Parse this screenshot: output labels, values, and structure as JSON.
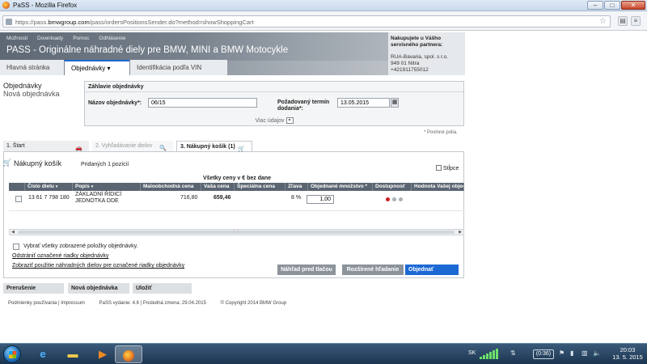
{
  "window": {
    "title": "PaSS - Mozilla Firefox",
    "url_prefix": "https://pass.",
    "url_domain": "bmwgroup.com",
    "url_path": "/pass/ordersPositionsSender.do?method=showShoppingCart"
  },
  "header": {
    "top_menu": [
      "Možnosti",
      "Downloady",
      "Pomoc",
      "Odhlásenie"
    ],
    "app_title": "PASS - Originálne náhradné diely pre BMW, MINI a BMW Motocykle",
    "partner_title": "Nakupujete u Vášho servisného partnera:",
    "partner_lines": [
      "RUA-Bavaria, spol. s r.o.",
      "949 01 Nitra",
      "+421911755012"
    ]
  },
  "tabs": {
    "home": "Hlavná stránka",
    "orders": "Objednávky",
    "orders_arrow": "▾",
    "vin": "Identifikácia podľa VIN"
  },
  "left": {
    "title": "Objednávky",
    "subtitle": "Nová objednávka"
  },
  "order_header": {
    "title": "Záhlavie objednávky",
    "name_label": "Názov objednávky*:",
    "name_value": "06/15",
    "date_label_1": "Požadovaný termín",
    "date_label_2": "dodania*:",
    "date_value": "13.05.2015",
    "more_data": "Viac údajov",
    "required_note": "* Povinné polia."
  },
  "steps": {
    "s1": "1. Štart",
    "s2": "2. Vyhľadávanie dielov",
    "s3": "3. Nákupný košík (1)"
  },
  "cart": {
    "title": "Nákupný košík",
    "added": "Pridaných 1 pozícií",
    "columns_button": "Stĺpce",
    "prices_note": "Všetky ceny v € bez dane",
    "columns": {
      "part_no": "Číslo dielu",
      "desc": "Popis",
      "retail": "Maloobchodná cena",
      "your_price": "Vaša cena",
      "special": "Špeciálna cena",
      "discount": "Zľava",
      "qty": "Objednané množstvo *",
      "avail": "Dostupnosť",
      "value": "Hodnota Vašej objednávky"
    },
    "rows": [
      {
        "part_no": "13 61 7 798 180",
        "desc_1": "ZÁKLADNÍ ŘÍDICÍ",
        "desc_2": "JEDNOTKA DDE",
        "retail": "716,80",
        "your_price": "659,46",
        "discount": "8 %",
        "qty": "1,00"
      }
    ],
    "availability_colors": [
      "#cc1f1f",
      "#aab0b7",
      "#aab0b7"
    ],
    "select_all": "Vybrať všetky zobrazené položky objednávky.",
    "remove_link": "Odstrániť označené riadky objednávky",
    "show_usage_link": "Zobraziť použitie náhradných dielov pre označené riadky objednávky",
    "print_preview": "Náhľad pred tlačou",
    "adv_search": "Rozšírené hľadanie",
    "order_btn": "Objednať"
  },
  "bottom": {
    "interrupt": "Prerušenie",
    "new_order": "Nová objednávka",
    "save": "Uložiť"
  },
  "footer": {
    "terms": "Podmienky používania | Impressum",
    "version": "PaSS vydanie: 4.6 | Posledná zmena: 29.04.2015",
    "copyright": "© Copyright 2014 BMW Group"
  },
  "taskbar": {
    "lang": "SK",
    "timer": "(0:36)",
    "time": "20:03",
    "date": "13. 5. 2015"
  },
  "colors": {
    "accent_blue": "#1c69d4",
    "table_header": "#5b6572"
  }
}
